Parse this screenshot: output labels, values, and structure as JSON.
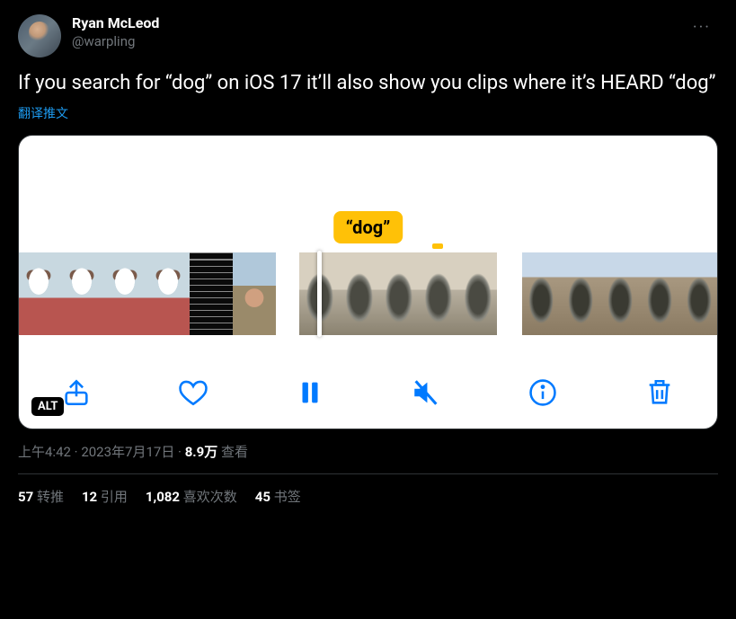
{
  "author": {
    "display_name": "Ryan McLeod",
    "handle": "@warpling"
  },
  "body": "If you search for “dog” on iOS 17 it’ll also show you clips where it’s HEARD “dog”",
  "translate_label": "翻译推文",
  "media": {
    "tag_label": "“dog”",
    "alt_badge": "ALT",
    "toolbar": {
      "share": "share-icon",
      "heart": "heart-icon",
      "pause": "pause-icon",
      "mute": "mute-icon",
      "info": "info-icon",
      "trash": "trash-icon"
    }
  },
  "meta": {
    "time": "上午4:42",
    "sep": " · ",
    "date": "2023年7月17日",
    "views_value": "8.9万",
    "views_label": " 查看"
  },
  "stats": {
    "retweets": {
      "num": "57",
      "label": " 转推"
    },
    "quotes": {
      "num": "12",
      "label": " 引用"
    },
    "likes": {
      "num": "1,082",
      "label": " 喜欢次数"
    },
    "bookmarks": {
      "num": "45",
      "label": " 书签"
    }
  }
}
